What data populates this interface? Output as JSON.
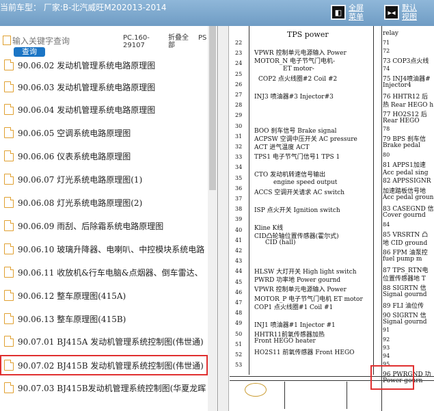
{
  "header": {
    "title": "当前车型： 厂家:B-北汽威旺M202013-2014",
    "fullscreen_label": "全屏菜单",
    "default_label": "默认视图"
  },
  "search": {
    "placeholder": "输入关键字查询",
    "query_label": "查询",
    "col_pc": "PC.160-29107",
    "col_fold": "折叠全部",
    "col_ps": "PS"
  },
  "list": {
    "items": [
      "90.06.02 发动机管理系统电路原理图",
      "90.06.03 发动机管理系统电路原理图",
      "90.06.04 发动机管理系统电路原理图",
      "90.06.05 空调系统电路原理图",
      "90.06.06 仪表系统电路原理图",
      "90.06.07 灯光系统电路原理图(1)",
      "90.06.08 灯光系统电路原理图(2)",
      "90.06.09 雨刮、后除霜系统电路原理图",
      "90.06.10 玻璃升降器、电喇叭、中控模块系统电路",
      "90.06.11 收放机&行车电脑&点烟器、倒车雷达、",
      "90.06.12 整车原理图(415A)",
      "90.06.13 整车原理图(415B)",
      "90.07.01 BJ415A 发动机管理系统控制图(伟世通)",
      "90.07.02 BJ415B 发动机管理系统控制图(伟世通)",
      "90.07.03 BJ415B发动机管理系统控制图(华夏龙晖"
    ],
    "selected_index": 13
  },
  "diagram": {
    "left_lines": [
      "TPS power",
      "VPWR 控制单元电源输入 Power",
      "MOTOR_N 电子节气门电机-",
      "ET motor-",
      "COP2 点火线圈#2 Coil #2",
      "INJ3 喷油器#3 Injector#3",
      "BOO 刹车信号 Brake signal",
      "ACPSW 空调中压开关 AC pressure",
      "ACT 进气温度 ACT",
      "TPS1 电子节气门信号1 TPS 1",
      "CTO 发动机转速信号输出",
      "engine speed output",
      "ACCS 空调开关请求 AC switch",
      "ISP 点火开关 Ignition switch",
      "Kline K线",
      "CID凸轮轴位置传感器(霍尔式)",
      "CID (hall)",
      "HLSW 大灯开关 High light switch",
      "PWRD 功率地 Power gournd",
      "VPWR 控制单元电源输入 Power",
      "MOTOR_P 电子节气门电机 ET motor",
      "COP1 点火线圈#1 Coil #1",
      "INJ1 喷油器#1 Injector #1",
      "HHTR11前氧传感器加热",
      "Front HEGO heater",
      "HO2S11 前氧传感器 Front HEGO"
    ],
    "right_lines": [
      "relay",
      "73 COP3点火线",
      "75 INJ4喷油器#",
      "Injector4",
      "76 HHTR12 后",
      "热 Rear HEGO h",
      "77 HO2S12 后",
      "Rear HEGO",
      "79 BPS 刹车信",
      "Brake pedal",
      "81 APPS1加速",
      "Acc pedal sing",
      "82 APPSSIGNR",
      "加速踏板信号地",
      "Acc pedal groun",
      "83 CASEGND 信",
      "Cover gournd",
      "85 VRSRTN 凸",
      "地 CID ground",
      "86 FPM 油泵控",
      "fuel pump m",
      "87 TPS_RTN电",
      "位置传感器地 T",
      "88 SIGRTN 信",
      "Signal gournd",
      "89 FLI 油位传",
      "90 SIGRTN 信",
      "Signal gournd",
      "96 PWRGND 功",
      "Power gourn"
    ],
    "pin_numbers": [
      "22",
      "23",
      "24",
      "25",
      "26",
      "27",
      "28",
      "29",
      "30",
      "31",
      "32",
      "33",
      "34",
      "35",
      "36",
      "37",
      "38",
      "39",
      "40",
      "41",
      "42",
      "43",
      "44",
      "45",
      "46",
      "47",
      "48",
      "49",
      "50",
      "51",
      "52",
      "53"
    ],
    "right_pins": [
      "71",
      "72",
      "74",
      "78",
      "80",
      "84",
      "91",
      "92",
      "93",
      "94",
      "95"
    ]
  }
}
